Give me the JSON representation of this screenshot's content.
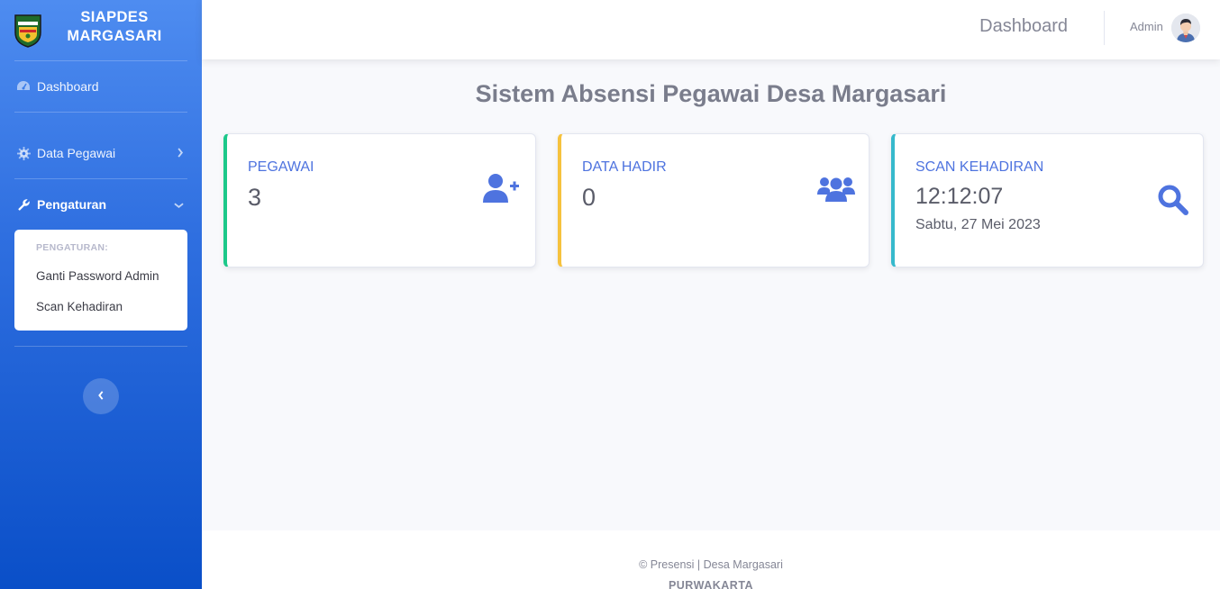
{
  "sidebar": {
    "brand": {
      "line1": "SIAPDES",
      "line2": "MARGASARI"
    },
    "items": [
      {
        "label": "Dashboard",
        "icon": "gauge-icon"
      },
      {
        "label": "Data Pegawai",
        "icon": "gear-icon"
      },
      {
        "label": "Pengaturan",
        "icon": "wrench-icon"
      }
    ],
    "submenu": {
      "header": "PENGATURAN:",
      "items": [
        {
          "label": "Ganti Password Admin"
        },
        {
          "label": "Scan Kehadiran"
        }
      ]
    }
  },
  "topbar": {
    "title": "Dashboard",
    "user": "Admin"
  },
  "main": {
    "heading": "Sistem Absensi Pegawai Desa Margasari",
    "cards": [
      {
        "label": "PEGAWAI",
        "value": "3",
        "icon": "user-plus-icon",
        "accent": "#1cc88a"
      },
      {
        "label": "DATA HADIR",
        "value": "0",
        "icon": "users-icon",
        "accent": "#f6c23e"
      },
      {
        "label": "SCAN KEHADIRAN",
        "value": "12:12:07",
        "sub": "Sabtu, 27 Mei 2023",
        "icon": "search-icon",
        "accent": "#36b9cc"
      }
    ]
  },
  "footer": {
    "line1": "© Presensi | Desa Margasari",
    "line2": "PURWAKARTA"
  },
  "colors": {
    "primary": "#4e73df",
    "sidebar_top": "#4e8cf0",
    "sidebar_bottom": "#0a4fc8"
  }
}
